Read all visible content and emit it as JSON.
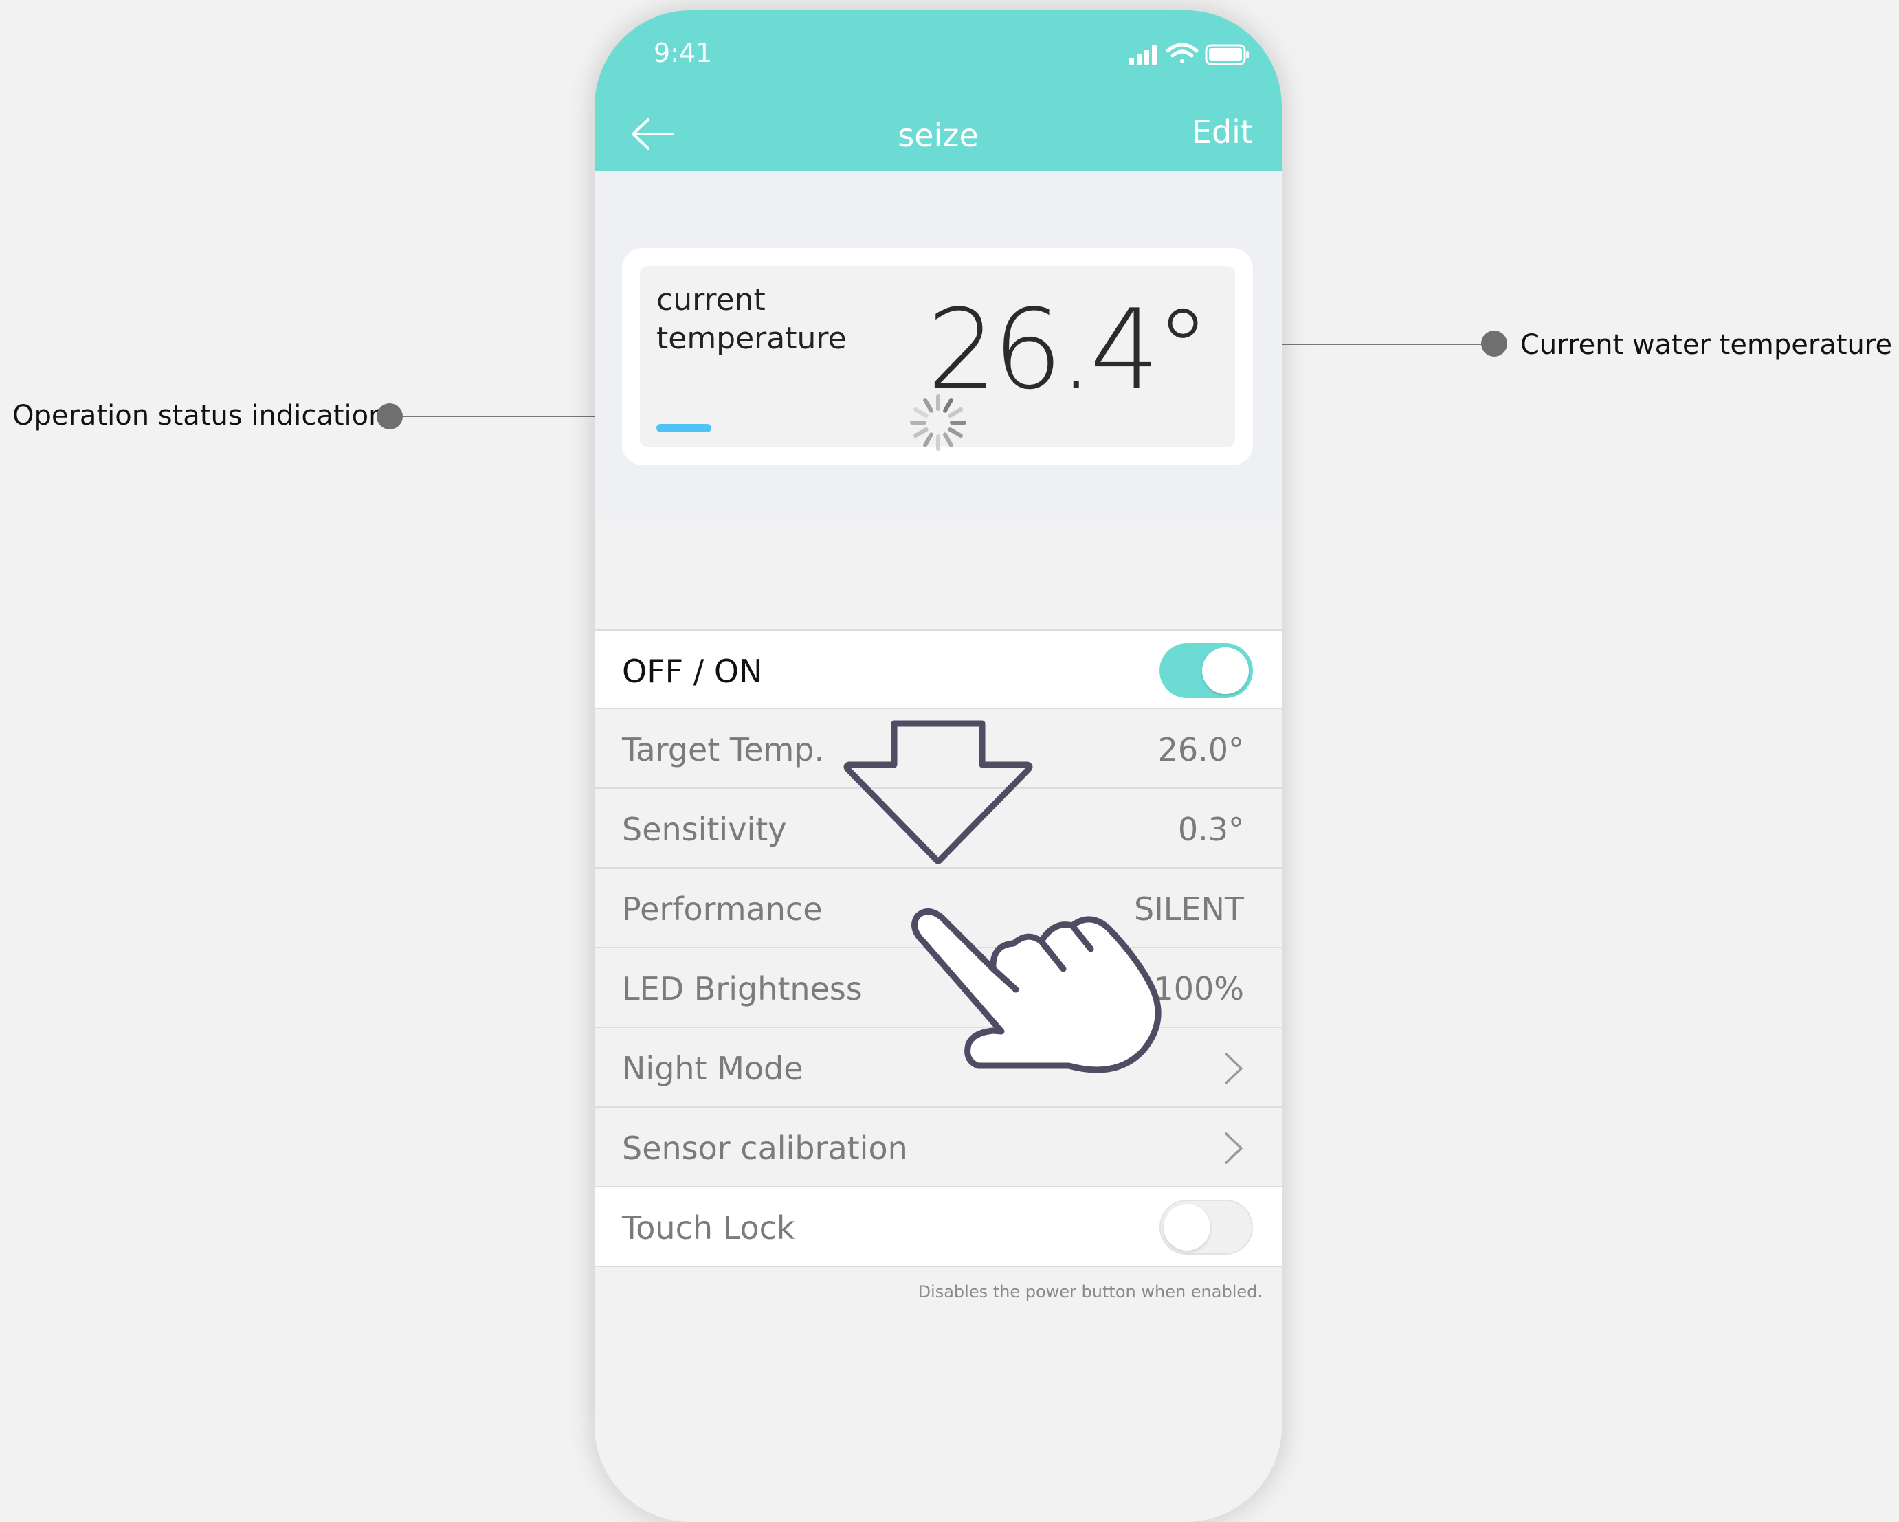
{
  "annotations": {
    "left_label": "Operation status indication",
    "right_label": "Current water temperature"
  },
  "status_bar": {
    "time": "9:41"
  },
  "nav": {
    "title": "seize",
    "edit_label": "Edit"
  },
  "hero": {
    "label": "current temperature",
    "value": "26.4°",
    "status_color": "#4fc3f7"
  },
  "settings": {
    "power": {
      "label": "OFF / ON",
      "enabled": true
    },
    "target_temp": {
      "label": "Target Temp.",
      "value": "26.0°"
    },
    "sensitivity": {
      "label": "Sensitivity",
      "value": "0.3°"
    },
    "performance": {
      "label": "Performance",
      "value": "SILENT"
    },
    "led_brightness": {
      "label": "LED Brightness",
      "value": "100%"
    },
    "night_mode": {
      "label": "Night Mode"
    },
    "sensor_calibration": {
      "label": "Sensor calibration"
    },
    "touch_lock": {
      "label": "Touch Lock",
      "enabled": false
    },
    "footnote": "Disables the power button when enabled."
  },
  "colors": {
    "accent": "#6bdbd4",
    "background": "#f2f2f2"
  }
}
